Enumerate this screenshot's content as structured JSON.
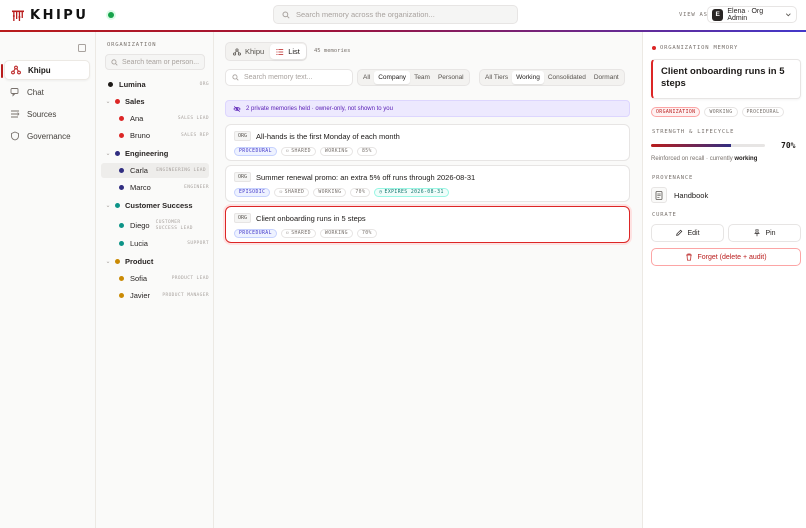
{
  "app": {
    "name": "KHIPU",
    "accent": "#b91c1c"
  },
  "topbar": {
    "search_placeholder": "Search memory across the organization...",
    "view_as_label": "VIEW AS",
    "user_initial": "E",
    "user_label": "Elena · Org Admin"
  },
  "nav": {
    "items": [
      {
        "label": "Khipu",
        "icon": "khipu-icon",
        "active": true
      },
      {
        "label": "Chat",
        "icon": "chat-icon"
      },
      {
        "label": "Sources",
        "icon": "sources-icon"
      },
      {
        "label": "Governance",
        "icon": "shield-icon"
      }
    ]
  },
  "org": {
    "section_label": "ORGANIZATION",
    "search_placeholder": "Search team or person...",
    "root": {
      "name": "Lumina",
      "badge": "ORG"
    },
    "teams": [
      {
        "name": "Sales",
        "color": "#dc2626",
        "members": [
          {
            "name": "Ana",
            "role": "SALES LEAD"
          },
          {
            "name": "Bruno",
            "role": "SALES REP"
          }
        ]
      },
      {
        "name": "Engineering",
        "color": "#312e81",
        "members": [
          {
            "name": "Carla",
            "role": "ENGINEERING LEAD",
            "selected": true
          },
          {
            "name": "Marco",
            "role": "ENGINEER"
          }
        ]
      },
      {
        "name": "Customer Success",
        "color": "#0d9488",
        "members": [
          {
            "name": "Diego",
            "role": "CUSTOMER SUCCESS LEAD"
          },
          {
            "name": "Lucia",
            "role": "SUPPORT"
          }
        ]
      },
      {
        "name": "Product",
        "color": "#ca8a04",
        "members": [
          {
            "name": "Sofia",
            "role": "PRODUCT LEAD"
          },
          {
            "name": "Javier",
            "role": "PRODUCT MANAGER"
          }
        ]
      }
    ]
  },
  "main": {
    "view_tabs": [
      {
        "label": "Khipu"
      },
      {
        "label": "List",
        "active": true
      }
    ],
    "memory_count": "45 memories",
    "search_placeholder": "Search memory text...",
    "scope_filters": [
      "All",
      "Company",
      "Team",
      "Personal"
    ],
    "scope_active": "Company",
    "tier_filters": [
      "All Tiers",
      "Working",
      "Consolidated",
      "Dormant"
    ],
    "tier_active": "Working",
    "private_banner": "2 private memories held · owner-only, not shown to you",
    "memories": [
      {
        "tag": "ORG",
        "title": "All-hands is the first Monday of each month",
        "type": "PROCEDURAL",
        "share": "SHARED",
        "tier": "WORKING",
        "strength": "85%"
      },
      {
        "tag": "ORG",
        "title": "Summer renewal promo: an extra 5% off runs through 2026-08-31",
        "type": "EPISODIC",
        "share": "SHARED",
        "tier": "WORKING",
        "strength": "70%",
        "expires": "EXPIRES 2026-08-31"
      },
      {
        "tag": "ORG",
        "title": "Client onboarding runs in 5 steps",
        "type": "PROCEDURAL",
        "share": "SHARED",
        "tier": "WORKING",
        "strength": "70%",
        "selected": true
      }
    ]
  },
  "detail": {
    "header": "ORGANIZATION MEMORY",
    "title": "Client onboarding runs in 5 steps",
    "chips": [
      "ORGANIZATION",
      "WORKING",
      "PROCEDURAL"
    ],
    "strength_label": "STRENGTH & LIFECYCLE",
    "strength_value": 0.7,
    "strength_pct": "70%",
    "reinforce_text": "Reinforced on recall · currently",
    "reinforce_state": "working",
    "provenance_label": "PROVENANCE",
    "provenance_source": "Handbook",
    "curate_label": "CURATE",
    "edit_label": "Edit",
    "pin_label": "Pin",
    "forget_label": "Forget (delete + audit)"
  }
}
